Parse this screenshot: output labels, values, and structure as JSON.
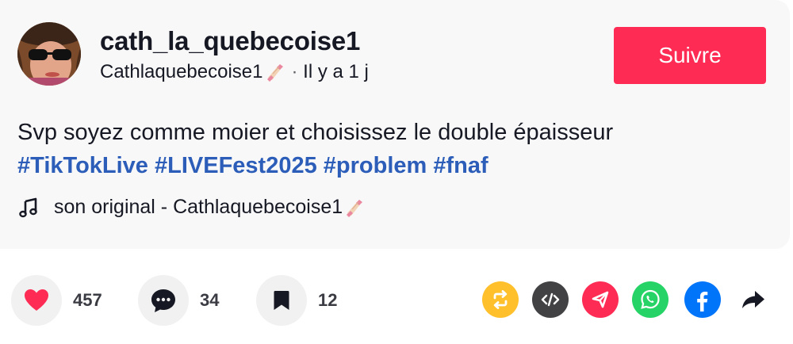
{
  "author": {
    "username": "cath_la_quebecoise1",
    "display_name": "Cathlaquebecoise1",
    "time_separator": "·",
    "posted_ago": "Il y a 1 j"
  },
  "follow_button": {
    "label": "Suivre"
  },
  "description": {
    "text": "Svp soyez comme moier et choisissez le double épaisseur",
    "hashtags": [
      "#TikTokLive",
      "#LIVEFest2025",
      "#problem",
      "#fnaf"
    ]
  },
  "music": {
    "icon": "music-note-icon",
    "label": "son original - Cathlaquebecoise1"
  },
  "actions": {
    "likes": "457",
    "comments": "34",
    "saves": "12"
  },
  "share": {
    "icons": [
      "repost-icon",
      "embed-icon",
      "send-icon",
      "whatsapp-icon",
      "facebook-icon",
      "share-arrow-icon"
    ]
  },
  "colors": {
    "accent": "#fe2c55",
    "hashtag": "#2b5db9",
    "repost": "#ffc02b",
    "embed": "#424244",
    "send": "#fe2c55",
    "whatsapp": "#25d366",
    "facebook": "#0075fa"
  }
}
